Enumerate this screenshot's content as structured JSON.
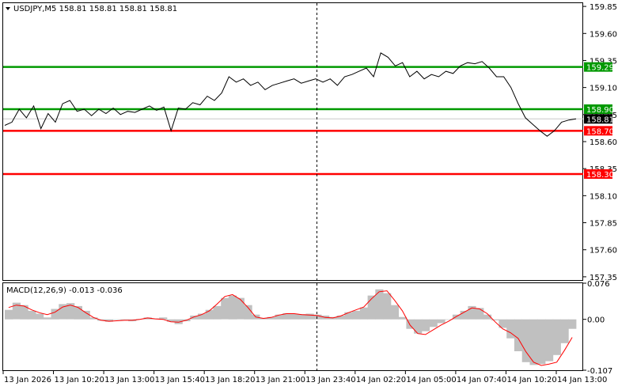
{
  "chart_data": [
    {
      "type": "line",
      "symbol_header": "USDJPY,M5  158.81 158.81 158.81 158.81",
      "ylim": [
        157.32,
        159.88
      ],
      "y_ticks": [
        "159.85",
        "159.60",
        "159.35",
        "159.10",
        "158.85",
        "158.60",
        "158.35",
        "158.10",
        "157.85",
        "157.60",
        "157.35"
      ],
      "x_ticks": [
        "13 Jan 2026",
        "13 Jan 10:20",
        "13 Jan 13:00",
        "13 Jan 15:40",
        "13 Jan 18:20",
        "13 Jan 21:00",
        "13 Jan 23:40",
        "14 Jan 02:20",
        "14 Jan 05:00",
        "14 Jan 07:40",
        "14 Jan 10:20",
        "14 Jan 13:00"
      ],
      "price_series": [
        158.75,
        158.78,
        158.9,
        158.82,
        158.93,
        158.72,
        158.86,
        158.78,
        158.95,
        158.98,
        158.88,
        158.9,
        158.84,
        158.9,
        158.86,
        158.91,
        158.85,
        158.88,
        158.87,
        158.9,
        158.93,
        158.89,
        158.92,
        158.7,
        158.91,
        158.9,
        158.96,
        158.94,
        159.02,
        158.98,
        159.05,
        159.2,
        159.15,
        159.18,
        159.12,
        159.15,
        159.08,
        159.12,
        159.14,
        159.16,
        159.18,
        159.14,
        159.16,
        159.18,
        159.15,
        159.18,
        159.12,
        159.2,
        159.22,
        159.25,
        159.28,
        159.2,
        159.42,
        159.38,
        159.3,
        159.33,
        159.2,
        159.25,
        159.18,
        159.22,
        159.2,
        159.25,
        159.23,
        159.3,
        159.33,
        159.32,
        159.34,
        159.28,
        159.2,
        159.2,
        159.1,
        158.95,
        158.82,
        158.76,
        158.7,
        158.65,
        158.7,
        158.78,
        158.8,
        158.81
      ],
      "horizontal_levels": [
        {
          "label": "159.29",
          "value": 159.29,
          "color": "#009900"
        },
        {
          "label": "158.90",
          "value": 158.9,
          "color": "#009900"
        },
        {
          "label": "158.70",
          "value": 158.7,
          "color": "#ff0000"
        },
        {
          "label": "158.30",
          "value": 158.3,
          "color": "#ff0000"
        }
      ],
      "current_price_label": "158.81",
      "current_price": 158.81,
      "grid": false,
      "vertical_marker_x_fraction": 0.553
    },
    {
      "type": "bar",
      "indicator_header": "MACD(12,26,9) -0.013 -0.036",
      "ylim": [
        -0.107,
        0.076
      ],
      "y_ticks": [
        "0.076",
        "0.00",
        "-0.107"
      ],
      "histogram_color": "#c0c0c0",
      "signal_color": "#ff0000",
      "macd_histogram": [
        0.02,
        0.035,
        0.03,
        0.018,
        0.012,
        0.004,
        0.022,
        0.032,
        0.034,
        0.028,
        0.018,
        0.004,
        -0.003,
        -0.005,
        -0.001,
        -0.002,
        -0.004,
        0.001,
        0.004,
        0.002,
        0.004,
        -0.005,
        -0.01,
        -0.004,
        0.008,
        0.012,
        0.02,
        0.028,
        0.045,
        0.05,
        0.045,
        0.03,
        0.01,
        0.003,
        0.005,
        0.01,
        0.013,
        0.012,
        0.011,
        0.012,
        0.01,
        0.008,
        0.005,
        0.008,
        0.015,
        0.018,
        0.025,
        0.05,
        0.063,
        0.055,
        0.03,
        0.005,
        -0.02,
        -0.03,
        -0.025,
        -0.016,
        -0.008,
        -0.001,
        0.01,
        0.018,
        0.028,
        0.024,
        0.01,
        -0.002,
        -0.018,
        -0.04,
        -0.067,
        -0.09,
        -0.096,
        -0.094,
        -0.088,
        -0.075,
        -0.05,
        -0.02
      ],
      "macd_signal": [
        0.025,
        0.03,
        0.028,
        0.02,
        0.014,
        0.01,
        0.015,
        0.026,
        0.03,
        0.025,
        0.014,
        0.004,
        -0.002,
        -0.004,
        -0.003,
        -0.002,
        -0.002,
        0.0,
        0.003,
        0.001,
        0.0,
        -0.005,
        -0.006,
        -0.002,
        0.005,
        0.01,
        0.018,
        0.032,
        0.048,
        0.052,
        0.042,
        0.025,
        0.005,
        0.002,
        0.004,
        0.009,
        0.012,
        0.012,
        0.01,
        0.009,
        0.008,
        0.004,
        0.003,
        0.007,
        0.014,
        0.02,
        0.026,
        0.043,
        0.058,
        0.06,
        0.04,
        0.018,
        -0.012,
        -0.03,
        -0.032,
        -0.022,
        -0.012,
        -0.004,
        0.006,
        0.015,
        0.024,
        0.022,
        0.012,
        -0.005,
        -0.02,
        -0.028,
        -0.04,
        -0.068,
        -0.09,
        -0.097,
        -0.094,
        -0.09,
        -0.065,
        -0.038
      ]
    }
  ]
}
